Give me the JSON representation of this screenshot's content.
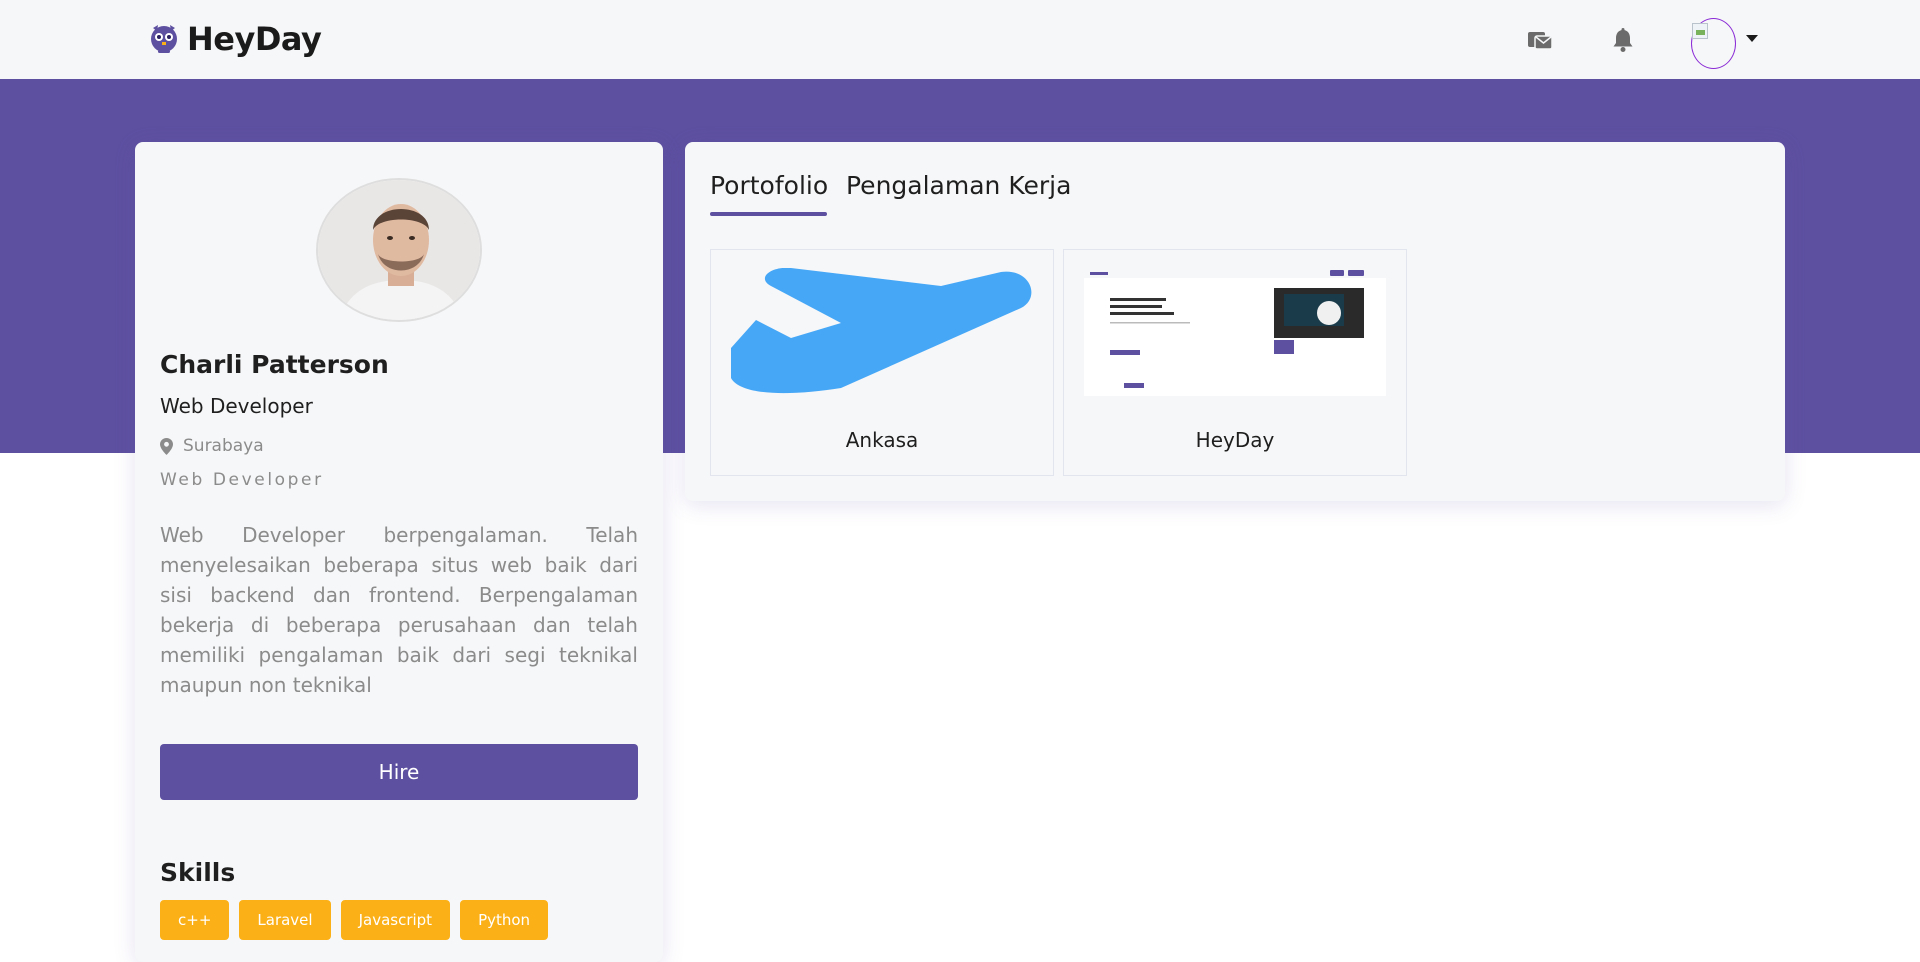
{
  "brand": {
    "name": "HeyDay",
    "primary": "#5e50a1",
    "accent": "#fbb017"
  },
  "navbar": {
    "icons": [
      "mail-icon",
      "bell-icon",
      "avatar",
      "caret-down-icon"
    ]
  },
  "profile": {
    "name": "Charli Patterson",
    "role": "Web Developer",
    "location": "Surabaya",
    "job": "Web Developer",
    "bio": "Web Developer berpengalaman. Telah menyelesaikan beberapa situs web baik dari sisi backend dan frontend. Berpengalaman bekerja di beberapa perusahaan dan telah memiliki pengalaman baik dari segi teknikal maupun non teknikal",
    "hire_label": "Hire",
    "skills_title": "Skills",
    "skills": [
      "c++",
      "Laravel",
      "Javascript",
      "Python"
    ]
  },
  "tabs": [
    "Portofolio",
    "Pengalaman Kerja"
  ],
  "portfolio": [
    {
      "label": "Ankasa",
      "thumb": "airplane-image"
    },
    {
      "label": "HeyDay",
      "thumb": "website-screenshot-image"
    }
  ]
}
